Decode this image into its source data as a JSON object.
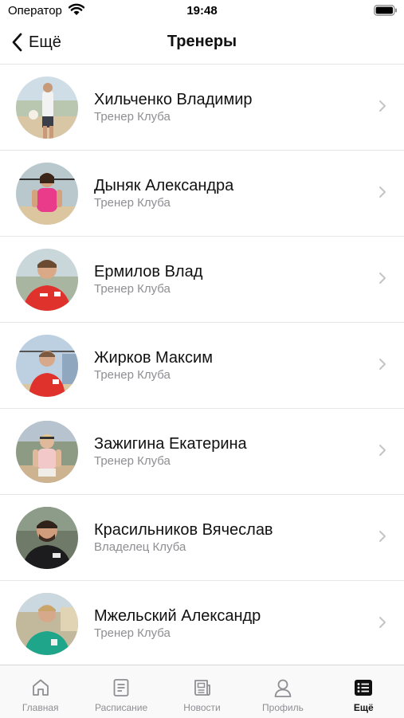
{
  "status_bar": {
    "carrier": "Оператор",
    "time": "19:48"
  },
  "nav": {
    "back_label": "Ещё",
    "title": "Тренеры"
  },
  "coaches": [
    {
      "name": "Хильченко Владимир",
      "role": "Тренер Клуба"
    },
    {
      "name": "Дыняк Александра",
      "role": "Тренер Клуба"
    },
    {
      "name": "Ермилов Влад",
      "role": "Тренер Клуба"
    },
    {
      "name": "Жирков Максим",
      "role": "Тренер Клуба"
    },
    {
      "name": "Зажигина Екатерина",
      "role": "Тренер Клуба"
    },
    {
      "name": "Красильников Вячеслав",
      "role": "Владелец Клуба"
    },
    {
      "name": "Мжельский Александр",
      "role": "Тренер Клуба"
    }
  ],
  "tabs": [
    {
      "label": "Главная",
      "icon": "home-icon"
    },
    {
      "label": "Расписание",
      "icon": "schedule-icon"
    },
    {
      "label": "Новости",
      "icon": "news-icon"
    },
    {
      "label": "Профиль",
      "icon": "profile-icon"
    },
    {
      "label": "Ещё",
      "icon": "more-icon",
      "active": true
    }
  ],
  "colors": {
    "accent": "#111111",
    "inactive": "#8e8e93",
    "separator": "#e6e6e8"
  }
}
